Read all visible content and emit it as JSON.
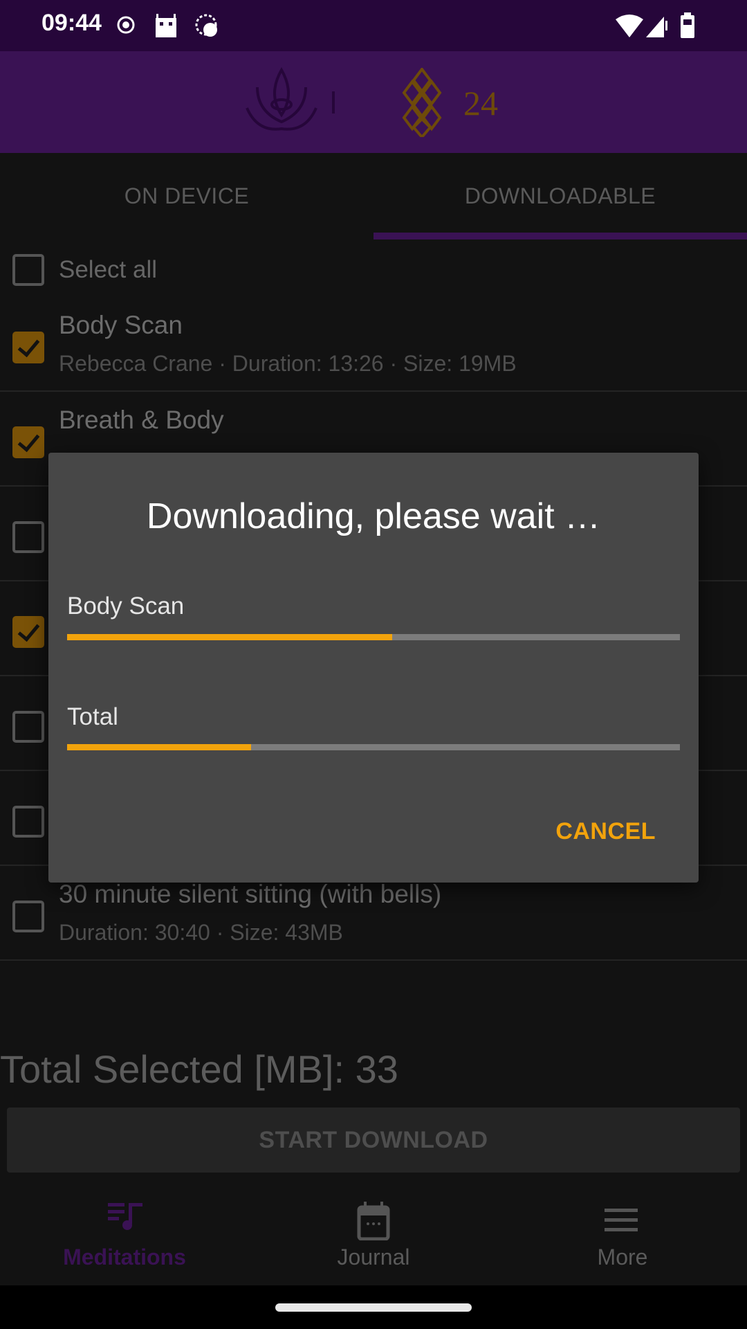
{
  "status_bar": {
    "time": "09:44",
    "icons": [
      "record-icon",
      "android-icon",
      "sync-icon",
      "wifi-icon",
      "signal-icon",
      "battery-icon"
    ]
  },
  "header": {
    "logo_text": "24"
  },
  "tabs": [
    {
      "label": "ON DEVICE",
      "active": false
    },
    {
      "label": "DOWNLOADABLE",
      "active": true
    }
  ],
  "select_all": {
    "label": "Select all",
    "checked": false
  },
  "items": [
    {
      "title": "Body Scan",
      "subtitle": "Rebecca Crane · Duration: 13:26 · Size: 19MB",
      "checked": true
    },
    {
      "title": "Breath & Body",
      "checked": true
    },
    {
      "checked": false
    },
    {
      "checked": true
    },
    {
      "checked": false
    },
    {
      "checked": false
    },
    {
      "title": "30 minute silent sitting (with bells)",
      "subtitle": "Duration: 30:40 · Size: 43MB",
      "checked": false
    }
  ],
  "dialog": {
    "title": "Downloading, please wait …",
    "current_label": "Body Scan",
    "current_progress": 0.53,
    "total_label": "Total",
    "total_progress": 0.3,
    "cancel_label": "CANCEL"
  },
  "total_selected": "Total Selected [MB]: 33",
  "start_download": "START DOWNLOAD",
  "bottom_nav": [
    {
      "label": "Meditations",
      "icon": "playlist-music-icon",
      "active": true
    },
    {
      "label": "Journal",
      "icon": "calendar-icon",
      "active": false
    },
    {
      "label": "More",
      "icon": "menu-icon",
      "active": false
    }
  ],
  "colors": {
    "accent": "#f2a30c",
    "primary": "#3a1254",
    "dialog": "#474747"
  }
}
